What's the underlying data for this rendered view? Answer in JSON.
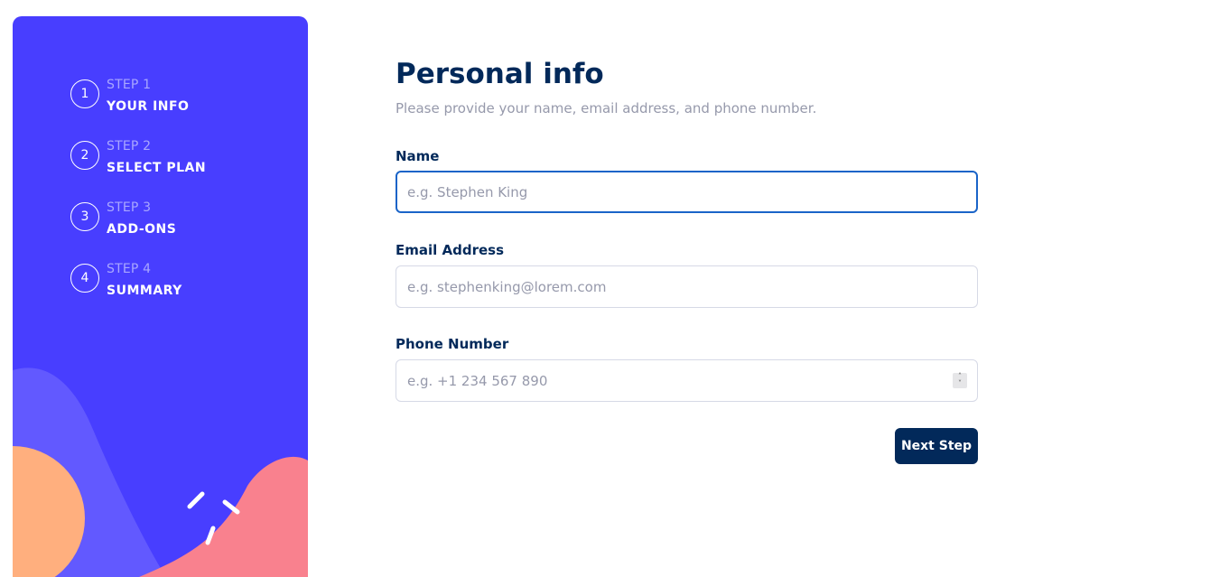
{
  "sidebar": {
    "steps": [
      {
        "number": "1",
        "label": "STEP 1",
        "title": "YOUR INFO"
      },
      {
        "number": "2",
        "label": "STEP 2",
        "title": "SELECT PLAN"
      },
      {
        "number": "3",
        "label": "STEP 3",
        "title": "ADD-ONS"
      },
      {
        "number": "4",
        "label": "STEP 4",
        "title": "SUMMARY"
      }
    ],
    "colors": {
      "background": "#483eff",
      "wave": "#6259ff",
      "circle": "#ffaf7e",
      "blob": "#f9818e"
    }
  },
  "main": {
    "title": "Personal info",
    "subtitle": "Please provide your name, email address, and phone number.",
    "fields": {
      "name": {
        "label": "Name",
        "placeholder": "e.g. Stephen King",
        "value": ""
      },
      "email": {
        "label": "Email Address",
        "placeholder": "e.g. stephenking@lorem.com",
        "value": ""
      },
      "phone": {
        "label": "Phone Number",
        "placeholder": "e.g. +1 234 567 890",
        "value": ""
      }
    },
    "next_button_label": "Next Step"
  },
  "colors": {
    "primary": "#02295a",
    "focus": "#1a64c8",
    "muted": "#9699ab",
    "border": "#d6d9e6"
  }
}
